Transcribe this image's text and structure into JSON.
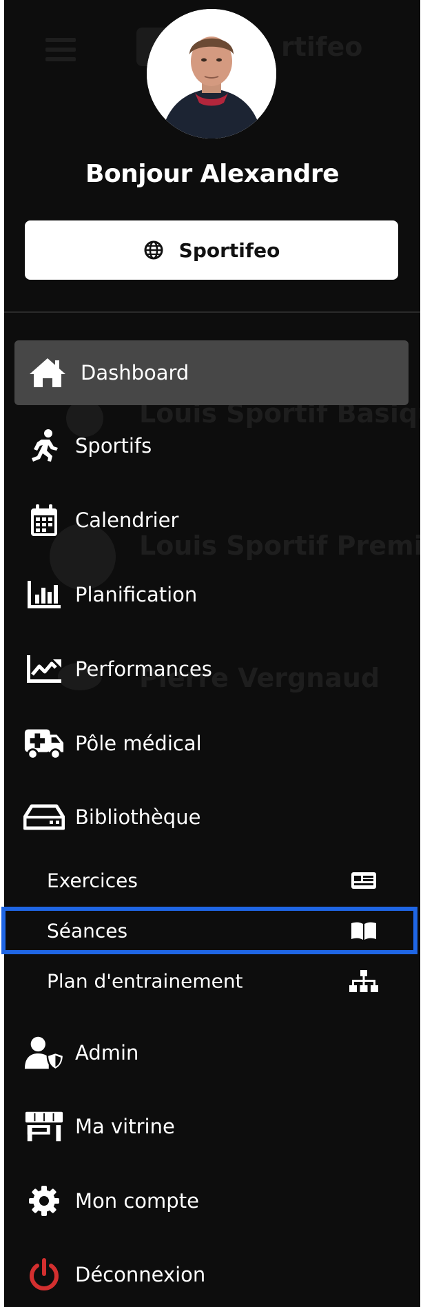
{
  "background_page": {
    "app_name": "rtifeo",
    "list_items": [
      "Louis Sportif Basiqu",
      "Louis Sportif Premiu",
      "Pierre Vergnaud"
    ]
  },
  "drawer": {
    "greeting": "Bonjour Alexandre",
    "organization_button": "Sportifeo",
    "nav": {
      "dashboard": "Dashboard",
      "sportifs": "Sportifs",
      "calendrier": "Calendrier",
      "planification": "Planification",
      "performances": "Performances",
      "pole_medical": "Pôle médical",
      "bibliotheque": "Bibliothèque",
      "admin": "Admin",
      "ma_vitrine": "Ma vitrine",
      "mon_compte": "Mon compte",
      "deconnexion": "Déconnexion"
    },
    "library_sub": {
      "exercices": "Exercices",
      "seances": "Séances",
      "plan": "Plan d'entrainement"
    },
    "active_item": "Dashboard",
    "highlighted_item": "Séances"
  },
  "colors": {
    "drawer_background": "#0d0d0d",
    "active_background": "#474747",
    "text": "#ffffff",
    "logout_icon": "#d32f2f",
    "highlight_border": "#1f66e5"
  },
  "icons": {
    "organization": "globe-icon",
    "dashboard": "home-icon",
    "sportifs": "running-icon",
    "calendrier": "calendar-icon",
    "planification": "bar-chart-icon",
    "performances": "line-chart-icon",
    "pole_medical": "ambulance-icon",
    "bibliotheque": "hdd-icon",
    "exercices": "newspaper-icon",
    "seances": "book-open-icon",
    "plan": "sitemap-icon",
    "admin": "user-shield-icon",
    "ma_vitrine": "store-icon",
    "mon_compte": "gear-icon",
    "deconnexion": "power-icon"
  }
}
